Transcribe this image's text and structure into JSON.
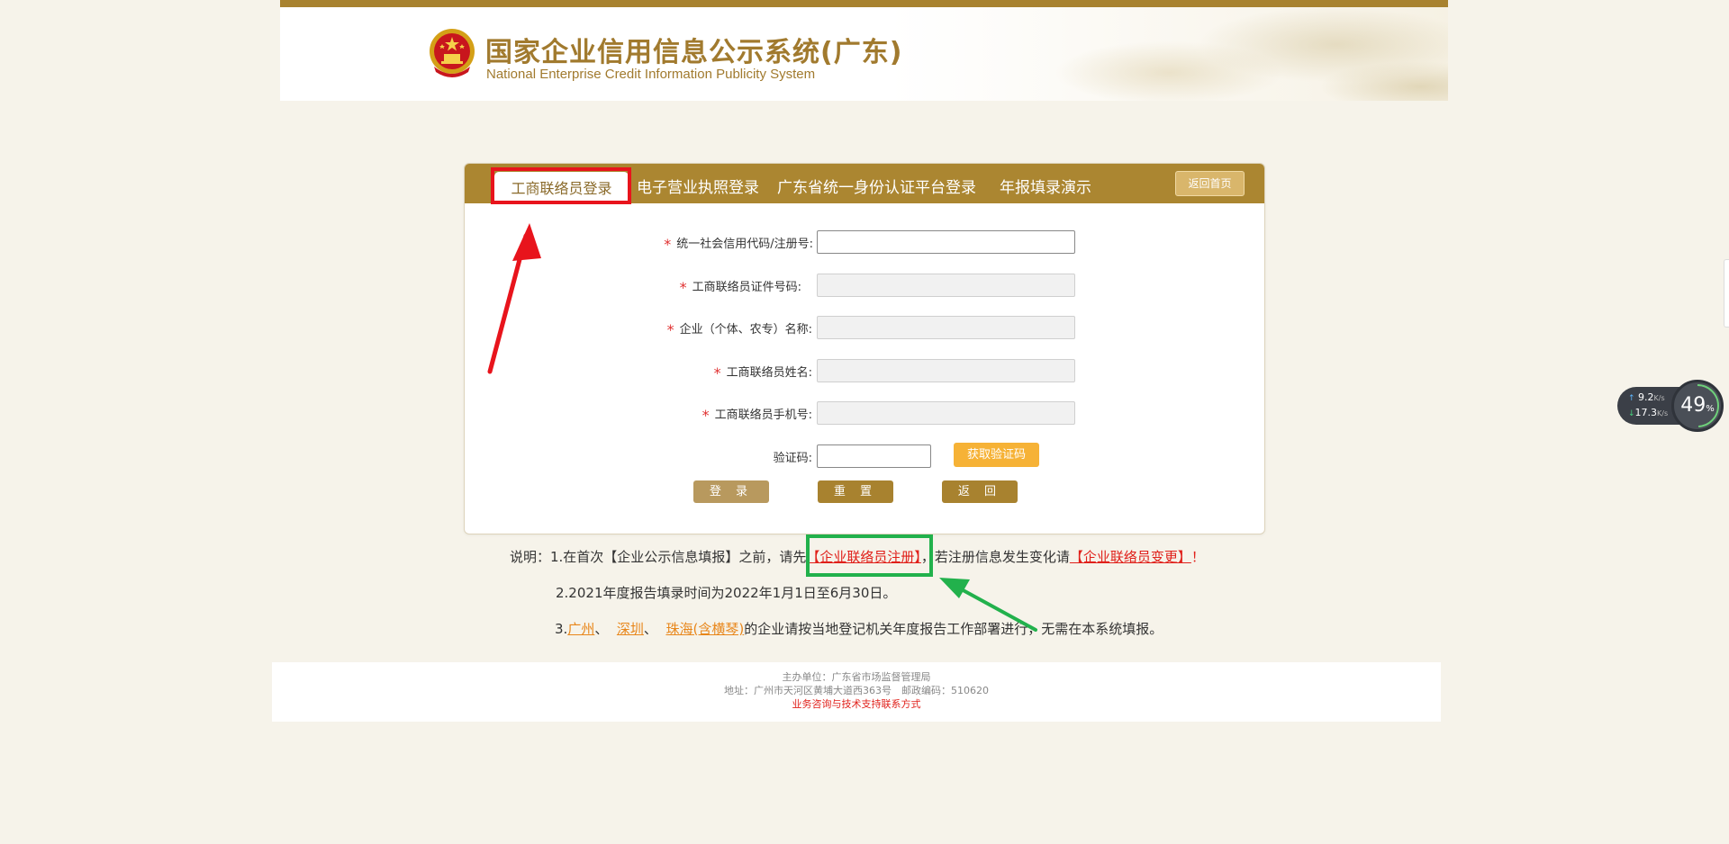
{
  "header": {
    "title": "国家企业信用信息公示系统(广东)",
    "subtitle": "National Enterprise Credit Information Publicity System"
  },
  "tabs": [
    {
      "label": "工商联络员登录",
      "active": true
    },
    {
      "label": "电子营业执照登录",
      "active": false
    },
    {
      "label": "广东省统一身份认证平台登录",
      "active": false
    },
    {
      "label": "年报填录演示",
      "active": false
    }
  ],
  "home_button": "返回首页",
  "form": {
    "fields": [
      {
        "label": "统一社会信用代码/注册号:",
        "required": true,
        "value": ""
      },
      {
        "label": "工商联络员证件号码:",
        "required": true,
        "value": ""
      },
      {
        "label": "企业（个体、农专）名称:",
        "required": true,
        "value": ""
      },
      {
        "label": "工商联络员姓名:",
        "required": true,
        "value": ""
      },
      {
        "label": "工商联络员手机号:",
        "required": true,
        "value": ""
      }
    ],
    "captcha_label": "验证码:",
    "captcha_value": "",
    "sms_button": "获取验证码",
    "login_button": "登 录",
    "reset_button": "重 置",
    "back_button": "返 回",
    "required_mark": "*"
  },
  "notes": {
    "line1_prefix": "说明：1.在首次【企业公示信息填报】之前，请先",
    "line1_link1": "【企业联络员注册】",
    "line1_mid": "，若注册信息发生变化请",
    "line1_link2": "【企业联络员变更】",
    "line1_suffix": "！",
    "line2": "2.2021年度报告填录时间为2022年1月1日至6月30日。",
    "line3_prefix": "3.",
    "line3_city1": "广州",
    "line3_sep1": "、",
    "line3_city2": "深圳",
    "line3_sep2": "、",
    "line3_city3": "珠海(含横琴)",
    "line3_suffix": "的企业请按当地登记机关年度报告工作部署进行，无需在本系统填报。"
  },
  "footer": {
    "sponsor": "主办单位：广东省市场监督管理局",
    "address": "地址：广州市天河区黄埔大道西363号　邮政编码：510620",
    "contact": "业务咨询与技术支持联系方式"
  },
  "net_widget": {
    "up_speed": "9.2",
    "up_unit": "K/s",
    "down_speed": "17.3",
    "down_unit": "K/s",
    "percent": "49",
    "percent_unit": "%"
  },
  "colors": {
    "brand_gold": "#a8822f",
    "required_red": "#e03030",
    "annotation_red": "#e8141c",
    "annotation_green": "#22b14c"
  }
}
